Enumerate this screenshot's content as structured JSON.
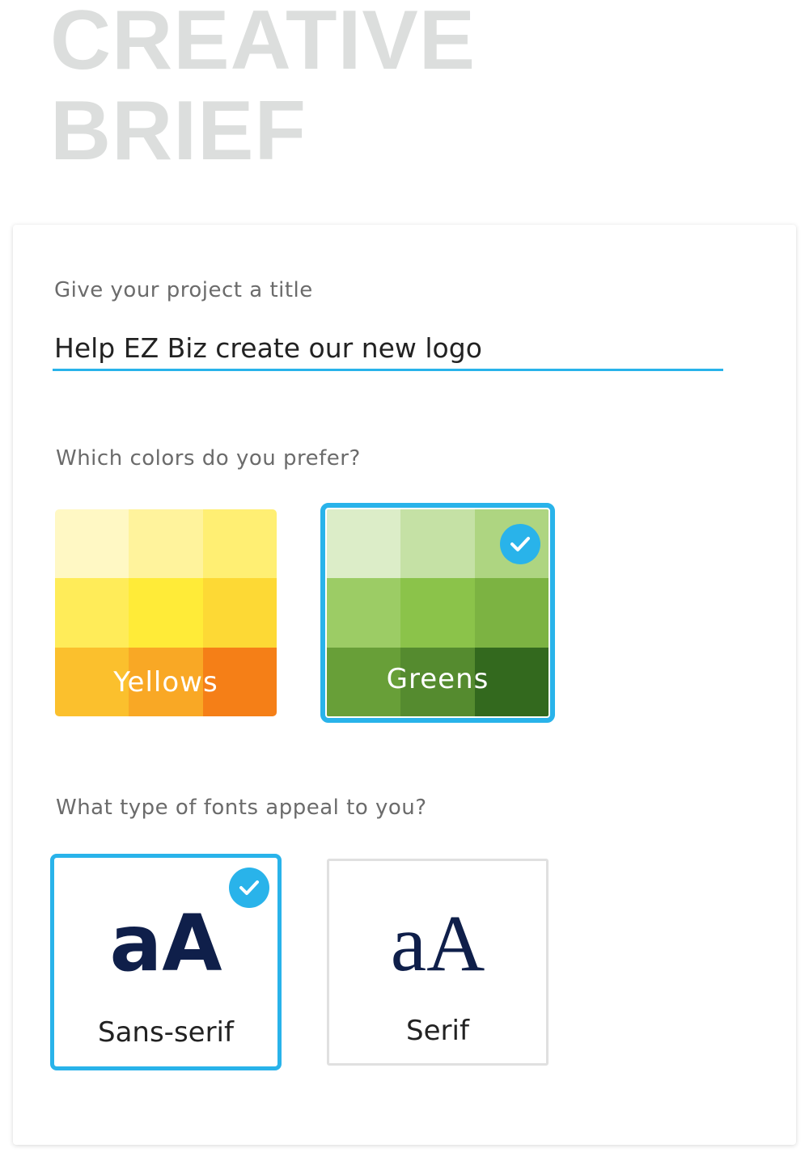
{
  "page": {
    "title": "CREATIVE\nBRIEF"
  },
  "project_title": {
    "label": "Give your project a title",
    "value": "Help EZ Biz create our new logo"
  },
  "colors": {
    "label": "Which colors do you prefer?",
    "options": [
      {
        "name": "Yellows",
        "selected": false,
        "palette": [
          "#fff8c4",
          "#fff39c",
          "#ffef73",
          "#ffec59",
          "#ffeb38",
          "#fdd935",
          "#fbc02d",
          "#f9a825",
          "#f57f17"
        ]
      },
      {
        "name": "Greens",
        "selected": true,
        "palette": [
          "#dcedc8",
          "#c5e1a5",
          "#aed581",
          "#9ccc65",
          "#8bc34a",
          "#7cb342",
          "#689f38",
          "#558b2f",
          "#33691e"
        ]
      }
    ],
    "selected_color": "#29b3ea"
  },
  "fonts": {
    "label": "What type of fonts appeal to you?",
    "options": [
      {
        "sample": "aA",
        "name": "Sans-serif",
        "selected": true
      },
      {
        "sample": "aA",
        "name": "Serif",
        "selected": false
      }
    ]
  }
}
